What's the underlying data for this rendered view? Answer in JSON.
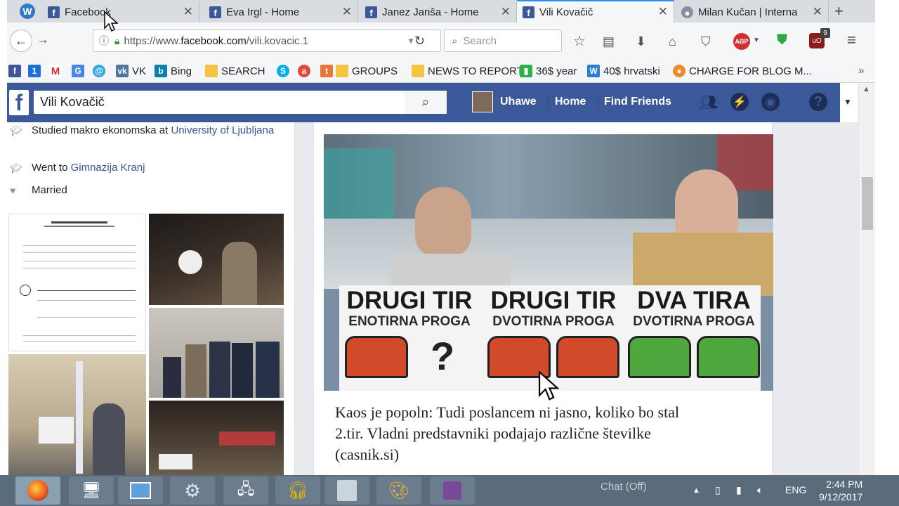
{
  "browser": {
    "tabs": [
      {
        "label": "Facebook",
        "active": false
      },
      {
        "label": "Eva Irgl - Home",
        "active": false
      },
      {
        "label": "Janez Janša - Home",
        "active": false
      },
      {
        "label": "Vili Kovačič",
        "active": true
      },
      {
        "label": "Milan Kučan | Interna",
        "active": false
      }
    ],
    "url_prefix": "https://www.",
    "url_domain": "facebook.com",
    "url_path": "/vili.kovacic.1",
    "search_placeholder": "Search",
    "ublock_count": "9",
    "bookmarks": [
      {
        "label": "VK"
      },
      {
        "label": "Bing"
      },
      {
        "label": "SEARCH"
      },
      {
        "label": "GROUPS"
      },
      {
        "label": "NEWS TO REPORT"
      },
      {
        "label": "36$ year"
      },
      {
        "label": "40$ hrvatski"
      },
      {
        "label": "CHARGE FOR BLOG M..."
      }
    ]
  },
  "facebook": {
    "search_value": "Vili Kovačič",
    "user_name": "Uhawe",
    "home_label": "Home",
    "find_friends_label": "Find Friends"
  },
  "intro": {
    "studied_prefix": "Studied makro ekonomska at ",
    "studied_school": "University of Ljubljana",
    "went_prefix": "Went to ",
    "went_school": "Gimnazija Kranj",
    "relationship": "Married"
  },
  "post": {
    "sign": [
      {
        "title": "DRUGI TIR",
        "subtitle": "ENOTIRNA PROGA"
      },
      {
        "title": "DRUGI TIR",
        "subtitle": "DVOTIRNA PROGA"
      },
      {
        "title": "DVA TIRA",
        "subtitle": "DVOTIRNA PROGA"
      }
    ],
    "question_mark": "?",
    "caption_line1": "Kaos je popoln: Tudi poslancem ni jasno, koliko bo stal",
    "caption_line2": "2.tir. Vladni predstavniki podajajo različne številke",
    "caption_line3": "(casnik.si)"
  },
  "chat": {
    "label": "Chat (Off)"
  },
  "taskbar": {
    "language": "ENG",
    "time": "2:44 PM",
    "date": "9/12/2017"
  },
  "colors": {
    "facebook_blue": "#3b5998",
    "link_blue": "#365899",
    "tab_accent": "#2a8cff",
    "taskbar": "#5a6c7c"
  }
}
